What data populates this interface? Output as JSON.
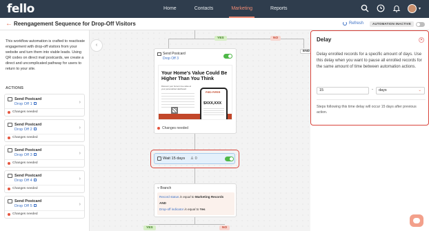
{
  "app": {
    "logo": "fello"
  },
  "nav": {
    "items": [
      "Home",
      "Contacts",
      "Marketing",
      "Reports"
    ],
    "active": "Marketing"
  },
  "header": {
    "title": "Reengagement Sequence for Drop-Off Visitors",
    "refresh_label": "Refresh",
    "status_badge": "AUTOMATION INACTIVE"
  },
  "left_panel": {
    "description": "This workflow automation is crafted to reactivate engagement with drop-off visitors from your website and turn them into viable leads. Using QR codes on direct mail postcards, we create a direct and uncomplicated pathway for users to return to your site.",
    "actions_label": "ACTIONS",
    "actions": [
      {
        "title": "Send Postcard",
        "link": "Drop Off 1",
        "status": "Changes needed"
      },
      {
        "title": "Send Postcard",
        "link": "Drop Off 2",
        "status": "Changes needed"
      },
      {
        "title": "Send Postcard",
        "link": "Drop Off 3",
        "status": "Changes needed"
      },
      {
        "title": "Send Postcard",
        "link": "Drop Off 4",
        "status": "Changes needed"
      },
      {
        "title": "Send Postcard",
        "link": "Drop Off 5",
        "status": "Changes needed"
      }
    ]
  },
  "canvas": {
    "top_branch": {
      "yes": "YES",
      "no": "NO",
      "end": "END"
    },
    "postcard_node": {
      "title": "Send Postcard",
      "link": "Drop Off 3",
      "preview_headline": "Your Home's Value Could Be Higher Than You Think",
      "preview_sub": "Discover your home's true value at your personalized dashboard",
      "preview_brand": "PIED PIPER",
      "preview_price": "$XXX,XXX",
      "status": "Changes needed"
    },
    "wait_node": {
      "label": "Wait 15 days",
      "count": "0"
    },
    "branch_node": {
      "title": "Branch",
      "cond1_field": "Record status",
      "cond1_op": "is equal to",
      "cond1_value": "Marketing Records",
      "joiner": "AND",
      "cond2_field": "Drop-off indicator",
      "cond2_op": "is equal to",
      "cond2_value": "Yes"
    },
    "bottom_branch": {
      "yes": "YES",
      "no": "NO"
    }
  },
  "delay_panel": {
    "title": "Delay",
    "description": "Delay enrolled records for a specific amount of days. Use this delay when you want to pause all enrolled records for the same amount of time between automation actions.",
    "amount": "15",
    "unit": "days",
    "note": "Steps following this time delay will occur 15 days after previous action."
  },
  "colors": {
    "accent": "#e56b4f",
    "nav_bg": "#2f3d4d",
    "link": "#3a6fc4",
    "highlight": "#d9433a"
  },
  "icons": [
    "search-icon",
    "clock-icon",
    "bell-icon",
    "avatar",
    "postcard-icon",
    "wait-icon",
    "branch-icon",
    "chat-icon"
  ]
}
